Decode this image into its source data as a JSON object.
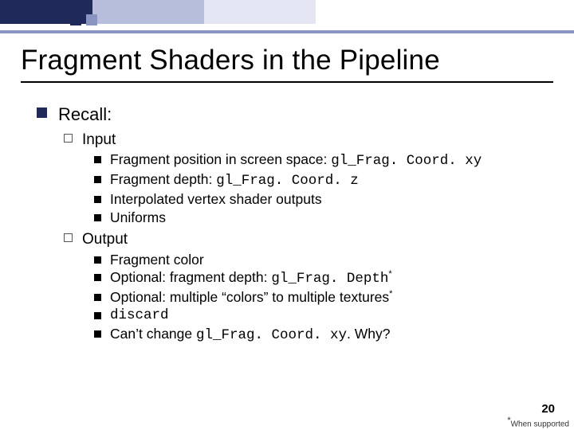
{
  "title": "Fragment Shaders in the Pipeline",
  "recall": "Recall:",
  "input_label": "Input",
  "output_label": "Output",
  "input": {
    "i0_pre": "Fragment position in screen space: ",
    "i0_code": "gl_Frag. Coord. xy",
    "i1_pre": "Fragment depth: ",
    "i1_code": "gl_Frag. Coord. z",
    "i2": "Interpolated vertex shader outputs",
    "i3": "Uniforms"
  },
  "output": {
    "o0": "Fragment color",
    "o1_pre": "Optional: fragment depth: ",
    "o1_code": "gl_Frag. Depth",
    "o2": "Optional: multiple “colors” to multiple textures",
    "o3_code": "discard",
    "o4_pre": "Can’t change ",
    "o4_code": "gl_Frag. Coord. xy",
    "o4_post": ". Why?"
  },
  "star": "*",
  "pagenum": "20",
  "footnote": "When supported",
  "footnote_star": "*"
}
